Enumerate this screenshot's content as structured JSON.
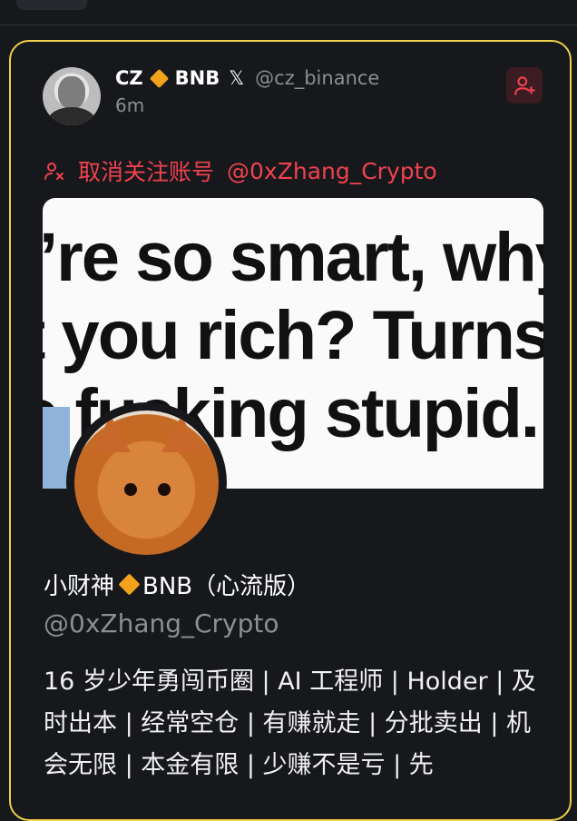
{
  "tweet": {
    "author_name": "CZ",
    "author_badge": "BNB",
    "x_icon": "𝕏",
    "author_handle": "@cz_binance",
    "time": "6m",
    "follow_icon": "add-user-icon",
    "unfollow_label": "取消关注账号",
    "unfollow_account": "@0xZhang_Crypto",
    "media_lines": [
      "’re so smart, why",
      "t you rich? Turns",
      "o fucking stupid."
    ]
  },
  "profile": {
    "name_part1": "小财神",
    "name_part2": "BNB（心流版）",
    "handle": "@0xZhang_Crypto",
    "bio": "16 岁少年勇闯币圈 | AI 工程师 | Holder | 及时出本 | 经常空仓 | 有赚就走 | 分批卖出 | 机会无限 | 本金有限 | 少赚不是亏 | 先"
  },
  "colors": {
    "accent_red": "#f0424e",
    "card_border": "#f0cf4a",
    "bnb": "#f3a21b"
  }
}
